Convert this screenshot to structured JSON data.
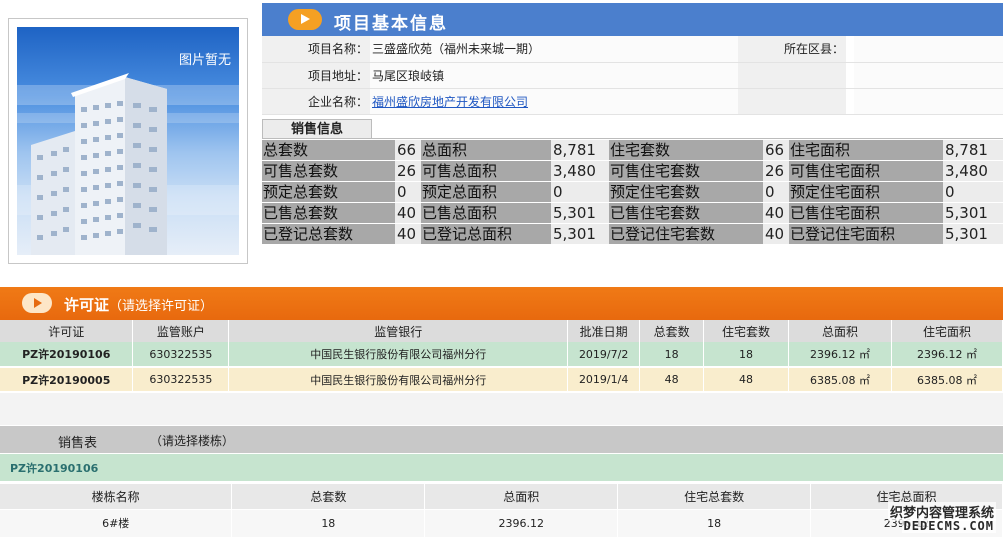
{
  "photo": {
    "placeholder": "图片暂无"
  },
  "basic_info": {
    "title": "项目基本信息",
    "project_name_label": "项目名称：",
    "project_name": "三盛盛欣苑（福州未来城一期）",
    "district_label": "所在区县：",
    "district": "",
    "address_label": "项目地址：",
    "address": "马尾区琅岐镇",
    "company_label": "企业名称：",
    "company": "福州盛欣房地产开发有限公司"
  },
  "sales_info": {
    "tab": "销售信息",
    "rows": [
      [
        [
          "总套数",
          "66"
        ],
        [
          "总面积",
          "8,781"
        ],
        [
          "住宅套数",
          "66"
        ],
        [
          "住宅面积",
          "8,781"
        ]
      ],
      [
        [
          "可售总套数",
          "26"
        ],
        [
          "可售总面积",
          "3,480"
        ],
        [
          "可售住宅套数",
          "26"
        ],
        [
          "可售住宅面积",
          "3,480"
        ]
      ],
      [
        [
          "预定总套数",
          "0"
        ],
        [
          "预定总面积",
          "0"
        ],
        [
          "预定住宅套数",
          "0"
        ],
        [
          "预定住宅面积",
          "0"
        ]
      ],
      [
        [
          "已售总套数",
          "40"
        ],
        [
          "已售总面积",
          "5,301"
        ],
        [
          "已售住宅套数",
          "40"
        ],
        [
          "已售住宅面积",
          "5,301"
        ]
      ],
      [
        [
          "已登记总套数",
          "40"
        ],
        [
          "已登记总面积",
          "5,301"
        ],
        [
          "已登记住宅套数",
          "40"
        ],
        [
          "已登记住宅面积",
          "5,301"
        ]
      ]
    ]
  },
  "permit": {
    "title": "许可证",
    "subtitle": "（请选择许可证）",
    "headers": [
      "许可证",
      "监管账户",
      "监管银行",
      "批准日期",
      "总套数",
      "住宅套数",
      "总面积",
      "住宅面积"
    ],
    "rows": [
      [
        "PZ许20190106",
        "630322535",
        "中国民生银行股份有限公司福州分行",
        "2019/7/2",
        "18",
        "18",
        "2396.12 ㎡",
        "2396.12 ㎡"
      ],
      [
        "PZ许20190005",
        "630322535",
        "中国民生银行股份有限公司福州分行",
        "2019/1/4",
        "48",
        "48",
        "6385.08 ㎡",
        "6385.08 ㎡"
      ]
    ]
  },
  "sales_table": {
    "title": "销售表",
    "hint": "（请选择楼栋）",
    "selected_permit": "PZ许20190106",
    "headers": [
      "楼栋名称",
      "总套数",
      "总面积",
      "住宅总套数",
      "住宅总面积"
    ],
    "rows": [
      [
        "6#楼",
        "18",
        "2396.12",
        "18",
        "2396.12"
      ]
    ]
  },
  "watermark": {
    "line1": "织梦内容管理系统",
    "line2": "DEDECMS.COM"
  }
}
